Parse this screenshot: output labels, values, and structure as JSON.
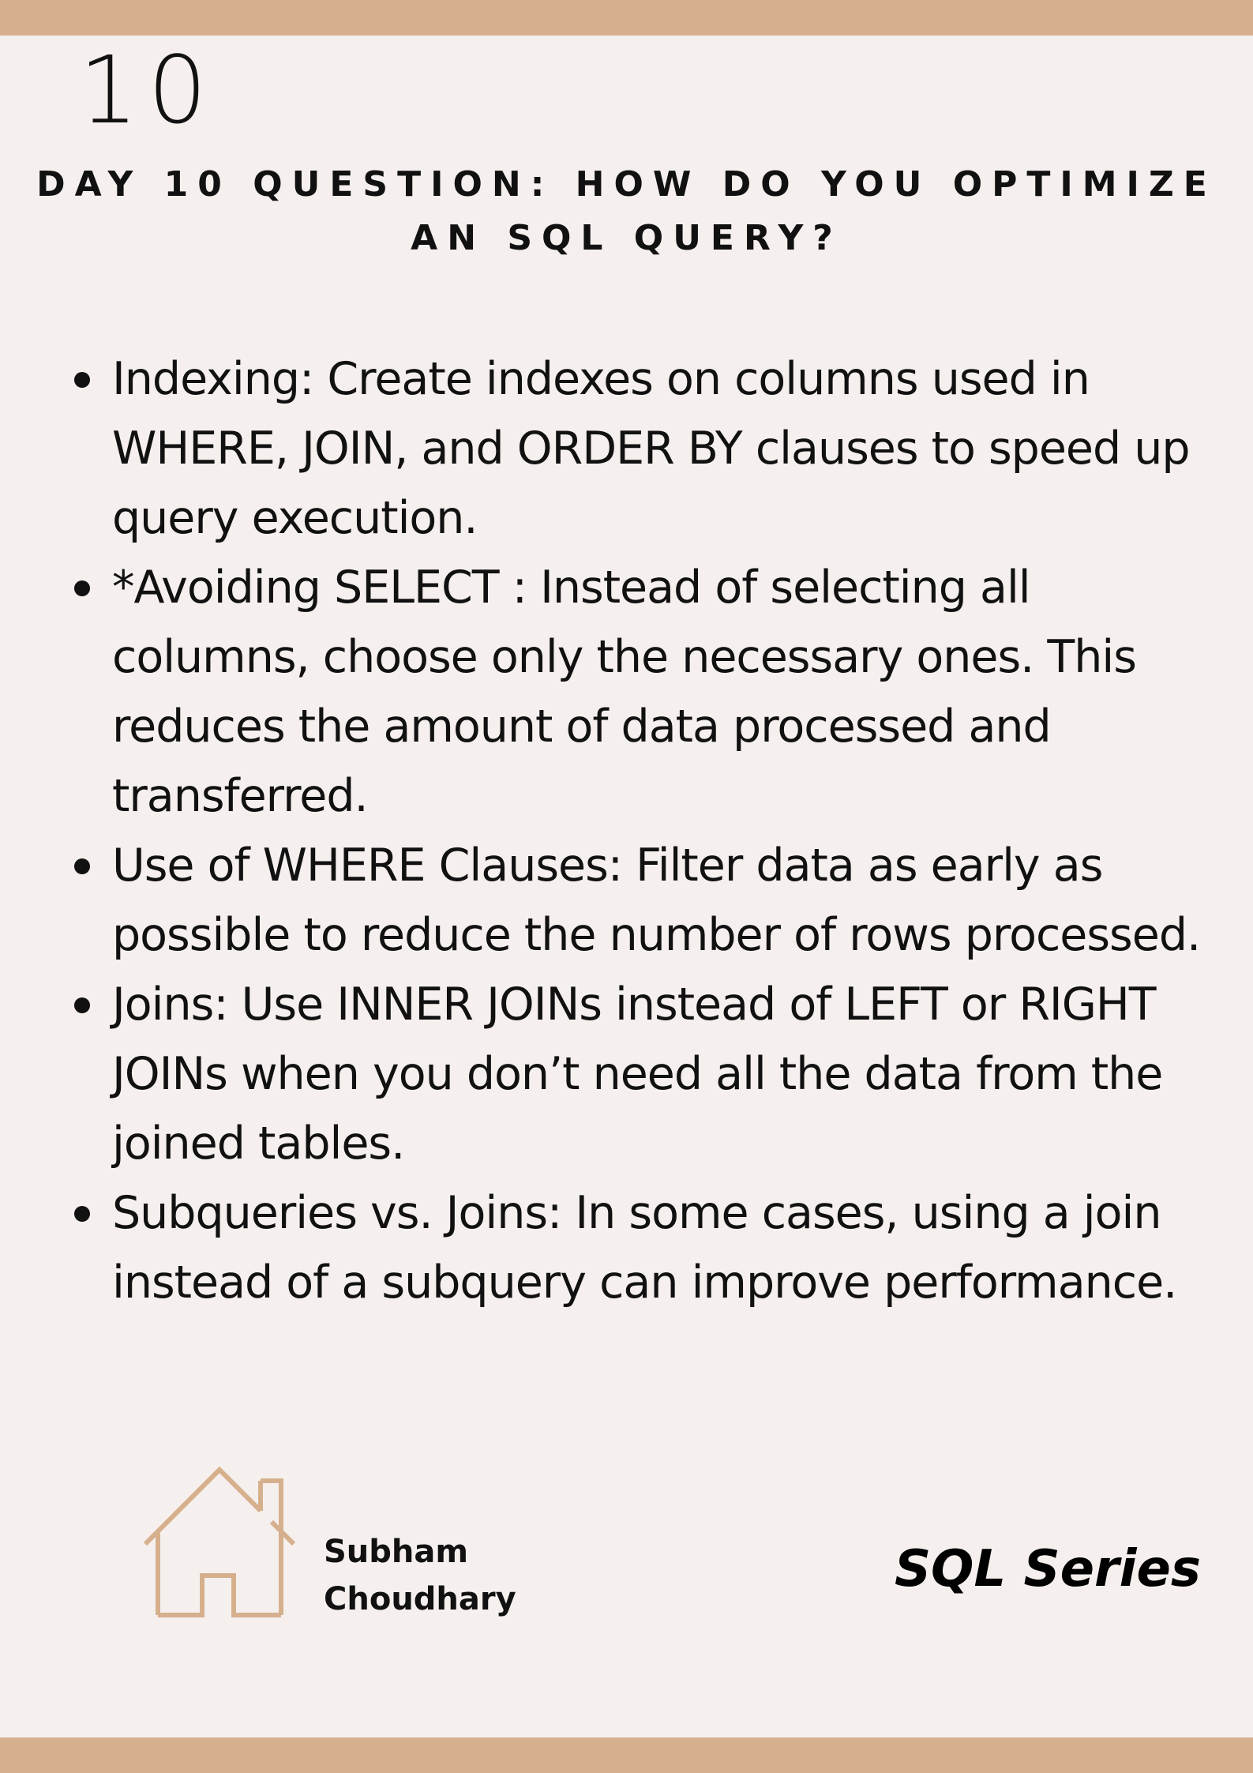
{
  "colors": {
    "background": "#f5f0ee",
    "accent": "#d6b08d",
    "text": "#111111"
  },
  "header": {
    "day_number": "10",
    "question": "DAY 10 QUESTION: HOW DO YOU OPTIMIZE AN SQL QUERY?"
  },
  "points": [
    "Indexing: Create indexes on columns used in WHERE, JOIN, and ORDER BY clauses to speed up query execution.",
    "*Avoiding SELECT : Instead of selecting all columns, choose only the necessary ones. This reduces the amount of data processed and transferred.",
    "Use of WHERE Clauses: Filter data as early as possible to reduce the number of rows processed.",
    "Joins: Use INNER JOINs instead of LEFT or RIGHT JOINs when you don’t need all the data from the joined tables.",
    "Subqueries vs. Joins: In some cases, using a join instead of a subquery can improve performance."
  ],
  "footer": {
    "icon": "house-icon",
    "author_first": "Subham",
    "author_last": "Choudhary",
    "series": "SQL Series"
  }
}
